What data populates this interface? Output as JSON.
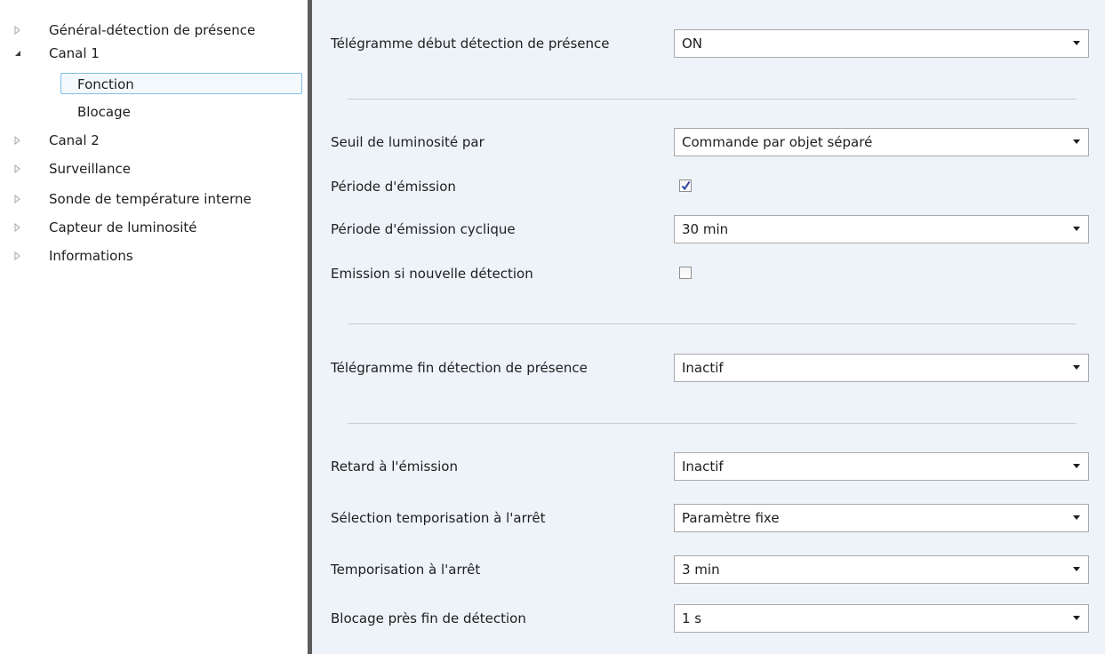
{
  "tree": {
    "items": [
      {
        "label": "Général-détection de présence",
        "state": "collapsed"
      },
      {
        "label": "Canal 1",
        "state": "expanded"
      },
      {
        "label": "Fonction",
        "state": "selected"
      },
      {
        "label": "Blocage",
        "state": "leaf"
      },
      {
        "label": "Canal 2",
        "state": "collapsed"
      },
      {
        "label": "Surveillance",
        "state": "collapsed"
      },
      {
        "label": "Sonde de température interne",
        "state": "collapsed"
      },
      {
        "label": "Capteur de luminosité",
        "state": "collapsed"
      },
      {
        "label": "Informations",
        "state": "collapsed"
      }
    ]
  },
  "params": {
    "telegram_start": {
      "label": "Télégramme début détection de présence",
      "value": "ON"
    },
    "threshold": {
      "label": "Seuil de luminosité par",
      "value": "Commande par objet séparé"
    },
    "emission_period": {
      "label": "Période d'émission",
      "checked": true
    },
    "cyclic_period": {
      "label": "Période d'émission cyclique",
      "value": "30 min"
    },
    "emission_new_detection": {
      "label": "Emission si nouvelle détection",
      "checked": false
    },
    "telegram_end": {
      "label": "Télégramme fin détection de présence",
      "value": "Inactif"
    },
    "send_delay": {
      "label": "Retard à l'émission",
      "value": "Inactif"
    },
    "off_delay_selection": {
      "label": "Sélection temporisation à l'arrêt",
      "value": "Paramètre fixe"
    },
    "off_delay": {
      "label": "Temporisation à l'arrêt",
      "value": "3 min"
    },
    "lock_after_detection": {
      "label": "Blocage près fin de détection",
      "value": "1 s"
    }
  },
  "colors": {
    "panel_bg": "#edf3f9",
    "splitter": "#5c5c5c",
    "selection_border": "#7fbfe8",
    "check_mark": "#2a3f9e"
  }
}
